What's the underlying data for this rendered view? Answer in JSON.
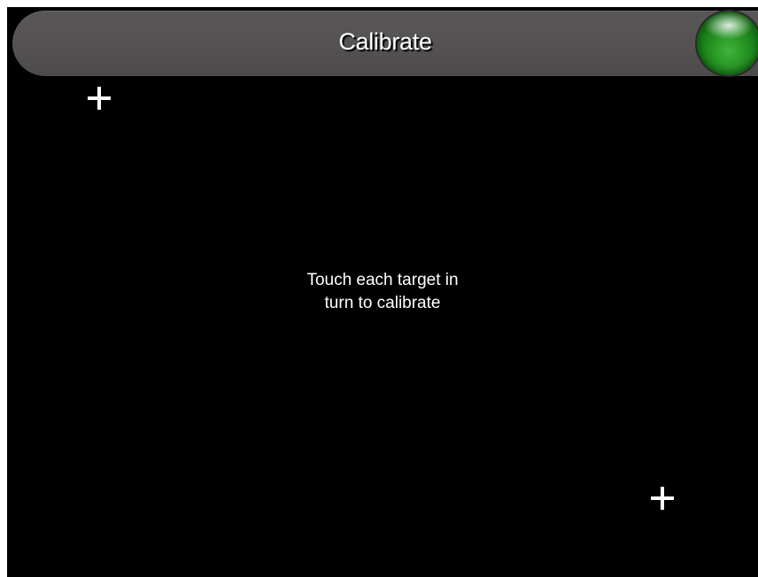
{
  "header": {
    "title": "Calibrate",
    "status_indicator": {
      "icon": "green-orb-icon",
      "color": "#2a9a27"
    }
  },
  "main": {
    "instruction_lines": [
      "Touch each target in",
      "turn to calibrate"
    ],
    "targets": [
      {
        "icon": "crosshair-target-icon",
        "label": "top-left target"
      },
      {
        "icon": "crosshair-target-icon",
        "label": "bottom-right target"
      }
    ]
  },
  "colors": {
    "background": "#000000",
    "title_bar": "#555253",
    "text": "#ffffff"
  }
}
